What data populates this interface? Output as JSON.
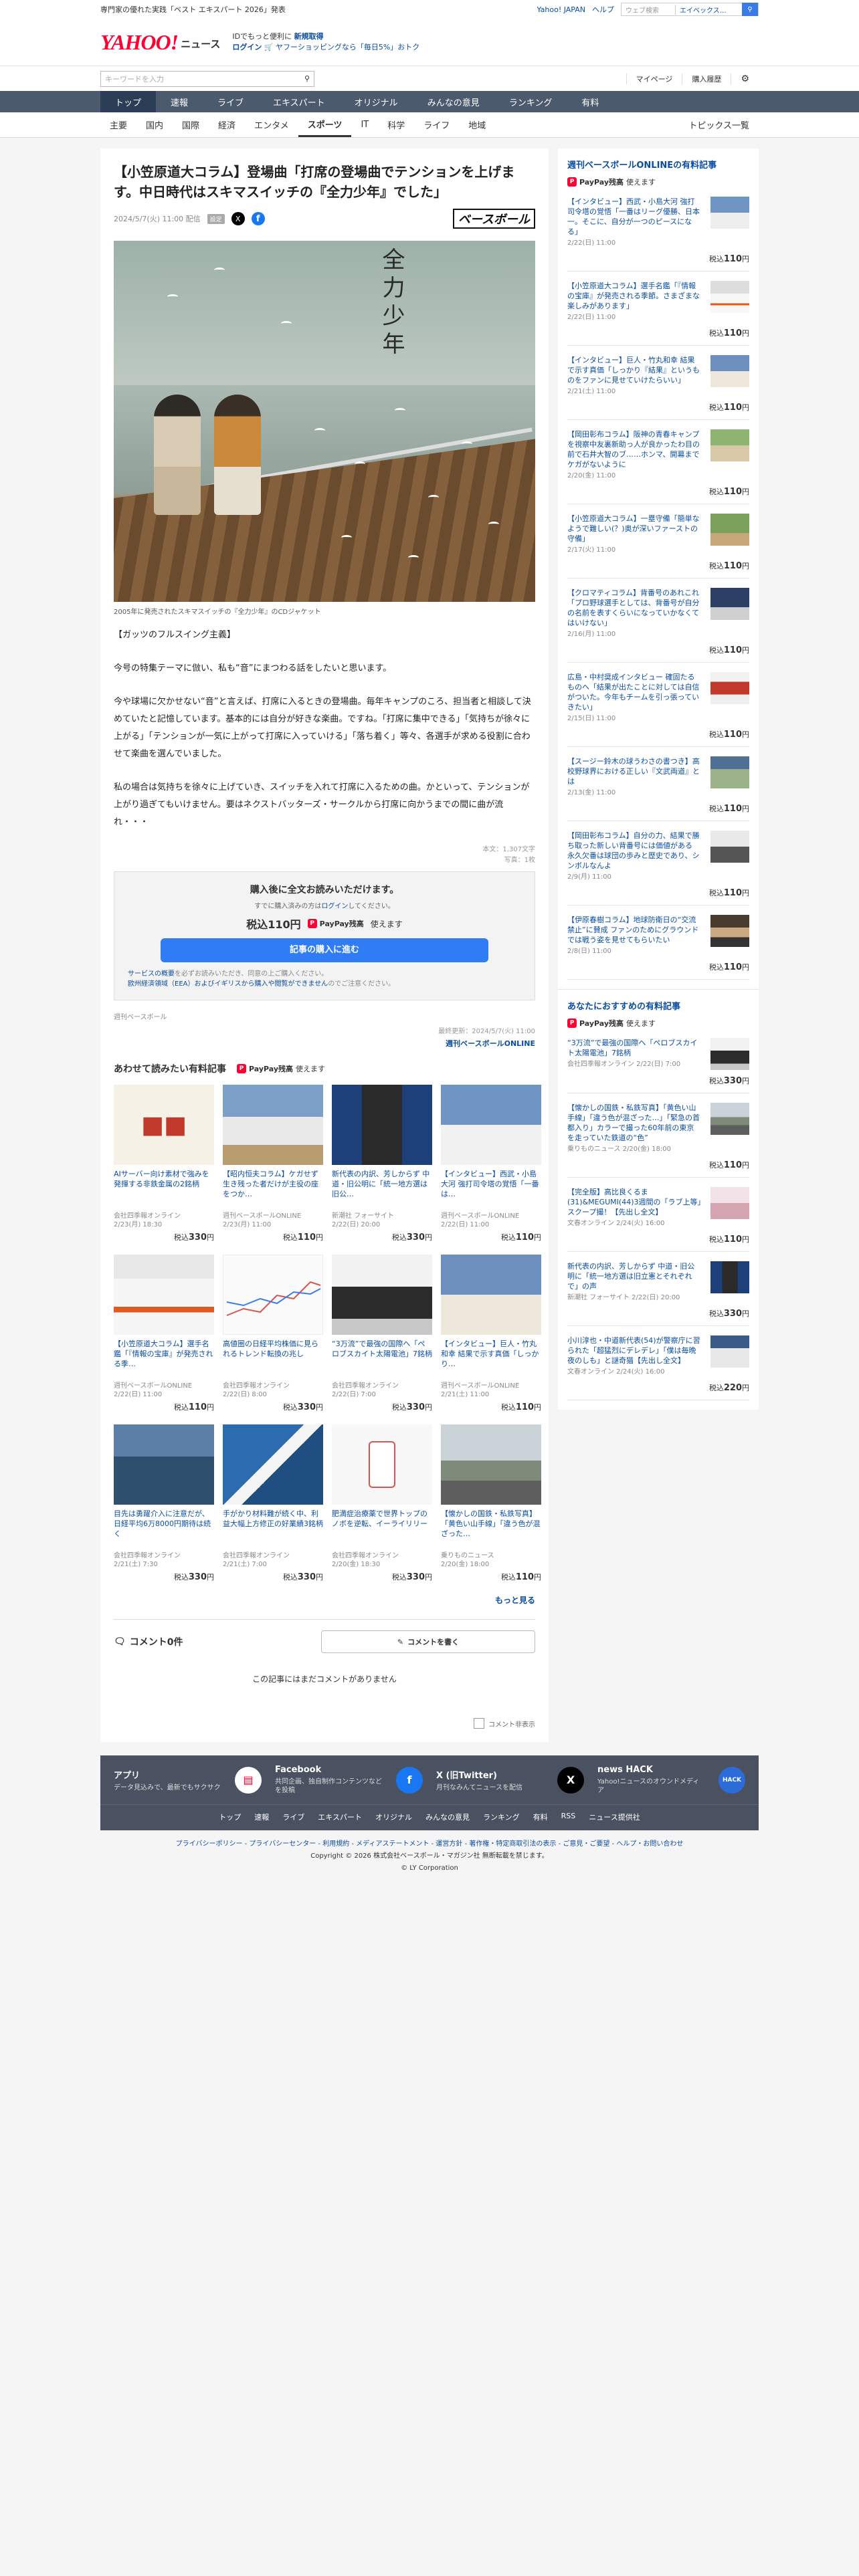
{
  "topbar": {
    "notice": "専門家の優れた実践「ベスト エキスパート 2026」発表",
    "links": [
      "Yahoo! JAPAN",
      "ヘルプ"
    ],
    "search_placeholder": "ウェブ検索",
    "search_scope": "エイベックス…"
  },
  "brand": {
    "logo_main": "YAHOO!",
    "logo_sub": "JAPAN",
    "logo_news": "ニュース",
    "promo_line1_prefix": "IDでもっと便利に",
    "promo_register": "新規取得",
    "promo_login": "ログイン",
    "promo_line2": "ヤフーショッピングなら「毎日5%」おトク"
  },
  "search": {
    "placeholder": "キーワードを入力",
    "links": [
      "マイページ",
      "購入履歴"
    ]
  },
  "nav": [
    "トップ",
    "速報",
    "ライブ",
    "エキスパート",
    "オリジナル",
    "みんなの意見",
    "ランキング",
    "有料"
  ],
  "subnav": [
    "主要",
    "国内",
    "国際",
    "経済",
    "エンタメ",
    "スポーツ",
    "IT",
    "科学",
    "ライフ",
    "地域"
  ],
  "subnav_right": "トピックス一覧",
  "article": {
    "title": "【小笠原道大コラム】登場曲「打席の登場曲でテンションを上げます。中日時代はスキマスイッチの『全力少年』でした」",
    "date": "2024/5/7(火) 11:00 配信",
    "config_badge": "設定",
    "source_logo": "ベースボール",
    "hero_title": "全力少年",
    "caption": "2005年に発売されたスキマスイッチの『全力少年』のCDジャケット",
    "paragraphs": [
      "【ガッツのフルスイング主義】",
      "今号の特集テーマに倣い、私も“音”にまつわる話をしたいと思います。",
      "今や球場に欠かせない“音”と言えば、打席に入るときの登場曲。毎年キャンプのころ、担当者と相談して決めていたと記憶しています。基本的には自分が好きな楽曲。ですね。「打席に集中できる」「気持ちが徐々に上がる」「テンションが一気に上がって打席に入っていける」「落ち着く」等々、各選手が求める役割に合わせて楽曲を選んでいました。",
      "私の場合は気持ちを徐々に上げていき、スイッチを入れて打席に入るための曲。かといって、テンションが上がり過ぎてもいけません。要はネクストバッターズ・サークルから打席に向かうまでの間に曲が流れ・・・"
    ],
    "char_count": "本文：1,307文字",
    "photo_count": "写真：1枚",
    "paywall": {
      "title": "購入後に全文お読みいただけます。",
      "sub_prefix": "すでに購入済みの方は",
      "sub_link": "ログイン",
      "sub_suffix": "してください。",
      "price": "税込110円",
      "paypay": "PayPay残高",
      "paypay_suffix": "使えます",
      "button": "記事の購入に進む",
      "notice_link1": "サービスの概要",
      "notice_text1": "を必ずお読みいただき、同意の上ご購入ください。",
      "notice_link2": "欧州経済領域（EEA）およびイギリスから購入や閲覧ができません",
      "notice_text2": "のでご注意ください。"
    },
    "source_name": "週刊ベースボール",
    "updated": "最終更新：2024/5/7(火) 11:00",
    "source_link": "週刊ベースボールONLINE"
  },
  "related": {
    "heading": "あわせて読みたい有料記事",
    "paypay": "PayPay残高",
    "paypay_suffix": "使えます",
    "cards": [
      {
        "title": "AIサーバー向け素材で強みを発揮する非鉄金属の2銘柄",
        "source": "会社四季報オンライン",
        "date": "2/23(月) 18:30",
        "price_prefix": "税込",
        "price": "330",
        "unit": "円"
      },
      {
        "title": "【昭内恒夫コラム】ケガせず生き残った者だけが主役の座をつか…",
        "source": "週刊ベースボールONLINE",
        "date": "2/23(月) 11:00",
        "price_prefix": "税込",
        "price": "110",
        "unit": "円"
      },
      {
        "title": "新代表の内訳、芳しからず 中道・旧公明に「統一地方選は旧公…",
        "source": "新潮社 フォーサイト",
        "date": "2/22(日) 20:00",
        "price_prefix": "税込",
        "price": "330",
        "unit": "円"
      },
      {
        "title": "【インタビュー】西武・小島大河 強打司令塔の覚悟「一番は…",
        "source": "週刊ベースボールONLINE",
        "date": "2/22(日) 11:00",
        "price_prefix": "税込",
        "price": "110",
        "unit": "円"
      },
      {
        "title": "【小笠原道大コラム】選手名鑑「『情報の宝庫』が発売される季…",
        "source": "週刊ベースボールONLINE",
        "date": "2/22(日) 11:00",
        "price_prefix": "税込",
        "price": "110",
        "unit": "円"
      },
      {
        "title": "高値圏の日経平均株価に見られるトレンド転換の兆し",
        "source": "会社四季報オンライン",
        "date": "2/22(日) 8:00",
        "price_prefix": "税込",
        "price": "330",
        "price_unit": "円",
        "unit": "円"
      },
      {
        "title": "“3万流”で最強の国際へ「ペロブスカイト太陽電池」7銘柄",
        "source": "会社四季報オンライン",
        "date": "2/22(日) 7:00",
        "price_prefix": "税込",
        "price": "330",
        "unit": "円"
      },
      {
        "title": "【インタビュー】巨人・竹丸和幸 結果で示す真価「しっかり…",
        "source": "週刊ベースボールONLINE",
        "date": "2/21(土) 11:00",
        "price_prefix": "税込",
        "price": "110",
        "unit": "円"
      },
      {
        "title": "目先は勇躍介入に注意だが、日経平均6万8000円期待は続く",
        "source": "会社四季報オンライン",
        "date": "2/21(土) 7:30",
        "price_prefix": "税込",
        "price": "330",
        "unit": "円"
      },
      {
        "title": "手がかり材料難が続く中、利益大幅上方修正の好業績3銘柄",
        "source": "会社四季報オンライン",
        "date": "2/21(土) 7:00",
        "price_prefix": "税込",
        "price": "330",
        "unit": "円"
      },
      {
        "title": "肥満症治療薬で世界トップのノボを逆転、イーライリリー",
        "source": "会社四季報オンライン",
        "date": "2/20(金) 18:30",
        "price_prefix": "税込",
        "price": "330",
        "unit": "円"
      },
      {
        "title": "【懐かしの国鉄・私鉄写真】「黄色い山手線」「違う色が混ざった…",
        "source": "乗りものニュース",
        "date": "2/20(金) 18:00",
        "price_prefix": "税込",
        "price": "110",
        "unit": "円"
      }
    ],
    "more": "もっと見る"
  },
  "comments": {
    "title": "コメント0件",
    "write": "コメントを書く",
    "empty": "この記事にはまだコメントがありません",
    "hide": "コメント非表示"
  },
  "sidebar1": {
    "heading": "週刊ベースボールONLINEの有料記事",
    "paypay": "PayPay残高",
    "paypay_suffix": "使えます",
    "items": [
      {
        "title": "【インタビュー】西武・小島大河 強打司令塔の覚悟「一番はリーグ優勝、日本一。そこに、自分が一つのピースになる」",
        "date": "2/22(日) 11:00",
        "price_prefix": "税込",
        "price": "110",
        "unit": "円"
      },
      {
        "title": "【小笠原道大コラム】選手名鑑「『情報の宝庫』が発売される季節。さまざまな楽しみがあります」",
        "date": "2/22(日) 11:00",
        "price_prefix": "税込",
        "price": "110",
        "unit": "円"
      },
      {
        "title": "【インタビュー】巨人・竹丸和幸 結果で示す真価「しっかり『結果』というものをファンに見せていけたらいい」",
        "date": "2/21(土) 11:00",
        "price_prefix": "税込",
        "price": "110",
        "unit": "円"
      },
      {
        "title": "【岡田彰布コラム】阪神の青春キャンプを視察中友裏新助っ人が良かったわ目の前で石井大智のブ……ホンマ、開幕までケガがないように",
        "date": "2/20(金) 11:00",
        "price_prefix": "税込",
        "price": "110",
        "unit": "円"
      },
      {
        "title": "【小笠原道大コラム】一塁守備「簡単なようで難しい(？)奥が深いファーストの守備」",
        "date": "2/17(火) 11:00",
        "price_prefix": "税込",
        "price": "110",
        "unit": "円"
      },
      {
        "title": "【クロマティコラム】背番号のあれこれ「プロ野球選手としては、背番号が自分の名前を表すくらいになっていかなくてはいけない」",
        "date": "2/16(月) 11:00",
        "price_prefix": "税込",
        "price": "110",
        "unit": "円"
      },
      {
        "title": "広島・中村奨成インタビュー 確固たるものへ「結果が出たことに対しては自信がついた。今年もチームを引っ張っていきたい」",
        "date": "2/15(日) 11:00",
        "price_prefix": "税込",
        "price": "110",
        "unit": "円"
      },
      {
        "title": "【スージー鈴木の球うわさの書つき】高校野球界における正しい『文武両道』とは",
        "date": "2/13(金) 11:00",
        "price_prefix": "税込",
        "price": "110",
        "unit": "円"
      },
      {
        "title": "【岡田彰布コラム】自分の力、結果で勝ち取った新しい背番号には価値がある 永久欠番は球団の歩みと歴史であり、シンボルなんよ",
        "date": "2/9(月) 11:00",
        "price_prefix": "税込",
        "price": "110",
        "unit": "円"
      },
      {
        "title": "【伊原春樹コラム】地球防衛日の“交流禁止”に賛成 ファンのためにグラウンドでは戦う姿を見せてもらいたい",
        "date": "2/8(日) 11:00",
        "price_prefix": "税込",
        "price": "110",
        "unit": "円"
      }
    ]
  },
  "sidebar2": {
    "heading": "あなたにおすすめの有料記事",
    "paypay": "PayPay残高",
    "paypay_suffix": "使えます",
    "items": [
      {
        "title": "“3万流”で最強の国際へ「ペロブスカイト太陽電池」7銘柄",
        "date": "会社四季報オンライン 2/22(日) 7:00",
        "price_prefix": "税込",
        "price": "330",
        "unit": "円"
      },
      {
        "title": "【懐かしの国鉄・私鉄写真】「黄色い山手線」「違う色が混ざった…」「緊急の首都入り」カラーで撮った60年前の東京を走っていた鉄道の“色”",
        "date": "乗りものニュース 2/20(金) 18:00",
        "price_prefix": "税込",
        "price": "110",
        "unit": "円"
      },
      {
        "title": "【完全版】高比良くるま(31)&MEGUMI(44)3週間の「ラブ上等」スクープ撮！【先出し全文】",
        "date": "文春オンライン 2/24(火) 16:00",
        "price_prefix": "税込",
        "price": "110",
        "unit": "円"
      },
      {
        "title": "新代表の内訳、芳しからず 中道・旧公明に「統一地方選は旧立憲とそれぞれで」の声",
        "date": "新潮社 フォーサイト 2/22(日) 20:00",
        "price_prefix": "税込",
        "price": "330",
        "unit": "円"
      },
      {
        "title": "小川淳也・中道新代表(54)が警察庁に習られた「超猛烈にデレデレ」「僕は毎晩夜のしも」と謎奇猫【先出し全文】",
        "date": "文春オンライン 2/24(火) 16:00",
        "price_prefix": "税込",
        "price": "220",
        "unit": "円"
      }
    ]
  },
  "footer": {
    "cards": [
      {
        "title": "アプリ",
        "sub": "データ見込みで、最新でもサクサク"
      },
      {
        "title": "Facebook",
        "sub": "共同企画、独自制作コンテンツなどを投稿"
      },
      {
        "title": "X (旧Twitter)",
        "sub": "月刊なみんてニュースを配信"
      },
      {
        "title": "news HACK",
        "sub": "Yahoo!ニュースのオウンドメディア"
      }
    ],
    "links": [
      "トップ",
      "速報",
      "ライブ",
      "エキスパート",
      "オリジナル",
      "みんなの意見",
      "ランキング",
      "有料",
      "RSS",
      "ニュース提供社"
    ],
    "legal": "プライバシーポリシー - プライバシーセンター - 利用規約 - メディアステートメント - 運営方針 - 著作権・特定商取引法の表示 - ご意見・ご要望 - ヘルプ・お問い合わせ",
    "copyright1": "Copyright © 2026 株式会社ベースボール・マガジン社 無断転載を禁じます。",
    "copyright2": "© LY Corporation"
  }
}
